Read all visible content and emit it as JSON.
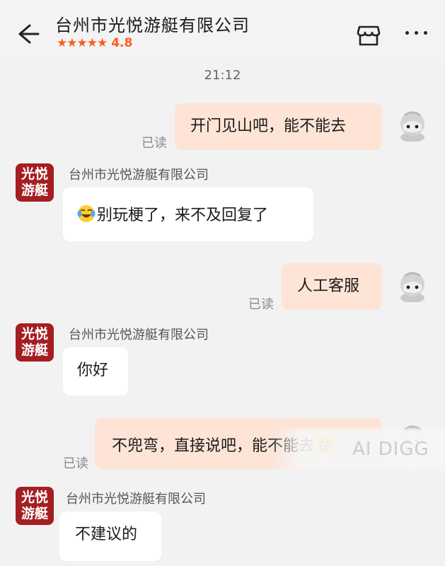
{
  "header": {
    "title": "台州市光悦游艇有限公司",
    "stars": "★★★★★",
    "rating": "4.8",
    "back_icon": "back-arrow-icon",
    "store_icon": "store-icon",
    "more_icon": "more-icon"
  },
  "time_label": "21:12",
  "shop": {
    "name": "台州市光悦游艇有限公司",
    "avatar_line1": "光悦",
    "avatar_line2": "游艇",
    "brand_color": "#a51e22"
  },
  "colors": {
    "outgoing_bubble": "#fde4d6",
    "incoming_bubble": "#ffffff",
    "rating": "#ff5a1f"
  },
  "read_label": "已读",
  "messages": [
    {
      "direction": "outgoing",
      "text": "开门见山吧，能不能去"
    },
    {
      "direction": "incoming",
      "emoji": "laughing-crying-emoji",
      "text": "别玩梗了，来不及回复了"
    },
    {
      "direction": "outgoing",
      "text": "人工客服"
    },
    {
      "direction": "incoming",
      "text": "你好"
    },
    {
      "direction": "outgoing",
      "text": "不兜弯，直接说吧，能不能去",
      "emoji": "grimace-emoji"
    },
    {
      "direction": "incoming",
      "text": "不建议的"
    }
  ],
  "watermark": "AI DIGG"
}
